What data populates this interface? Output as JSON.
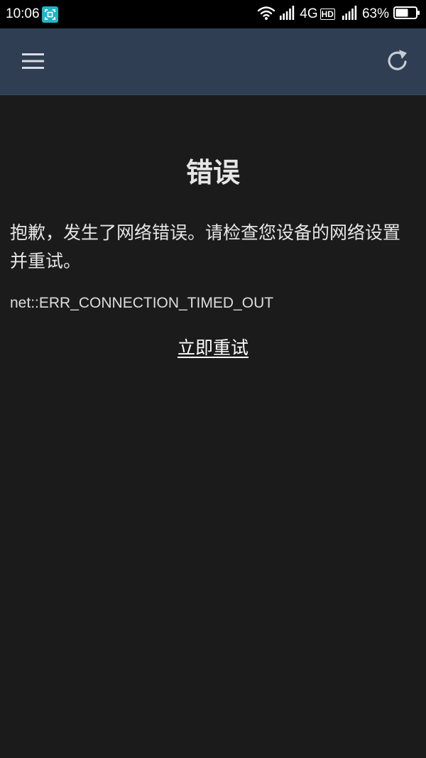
{
  "status_bar": {
    "time": "10:06",
    "network_type": "4G",
    "hd_label": "HD",
    "battery_percent": "63%",
    "battery_level": 0.63,
    "icons": [
      "screenshot-icon",
      "wifi-icon",
      "cell-signal-icon",
      "cell-signal-icon",
      "battery-icon"
    ]
  },
  "app_bar": {
    "menu_icon": "hamburger-menu-icon",
    "refresh_icon": "refresh-icon",
    "background_color": "#2f3e52"
  },
  "error": {
    "title": "错误",
    "message": "抱歉，发生了网络错误。请检查您设备的网络设置并重试。",
    "code": "net::ERR_CONNECTION_TIMED_OUT",
    "retry_label": "立即重试"
  },
  "colors": {
    "background": "#1b1b1b",
    "text": "#e6e6e6",
    "accent": "#1fb5c8"
  }
}
